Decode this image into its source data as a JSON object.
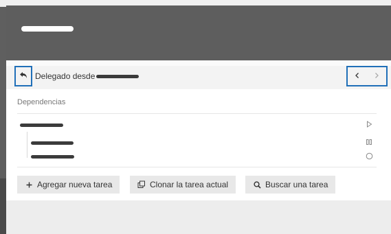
{
  "delegated": {
    "label": "Delegado desde"
  },
  "dependencies": {
    "title": "Dependencias",
    "rows": [
      {
        "icon": "play-outline-icon"
      },
      {
        "icon": "pause-outline-icon"
      },
      {
        "icon": "circle-outline-icon"
      }
    ]
  },
  "actions": {
    "add_task": "Agregar nueva tarea",
    "clone_task": "Clonar la tarea actual",
    "search_task": "Buscar una tarea"
  },
  "colors": {
    "header": "#5e5e5e",
    "accent_border": "#1f6fb8",
    "panel": "#ededed",
    "button": "#e8e8e8"
  }
}
